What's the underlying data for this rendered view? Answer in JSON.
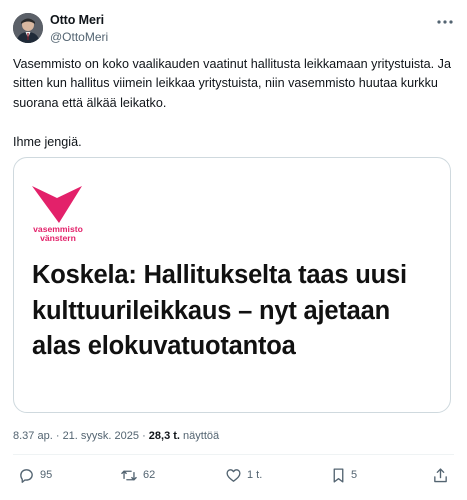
{
  "author": {
    "name": "Otto Meri",
    "handle": "@OttoMeri"
  },
  "post": {
    "paragraphs": [
      "Vasemmisto on koko vaalikauden vaatinut hallitusta leikkamaan yritystuista. Ja sitten kun hallitus viimein leikkaa yritystuista, niin vasemmisto huutaa kurkku suorana että älkää leikatko.",
      "Ihme jengiä."
    ]
  },
  "card": {
    "brand_line1": "vasemmisto",
    "brand_line2": "vänstern",
    "headline": "Koskela: Hallitukselta taas uusi kulttuurileikkaus – nyt ajetaan alas elokuvatuotantoa"
  },
  "meta": {
    "time": "8.37 ap.",
    "separator": "·",
    "date": "21. syysk. 2025",
    "views_count": "28,3 t.",
    "views_label": "näyttöä"
  },
  "actions": {
    "replies": "95",
    "reposts": "62",
    "likes": "1 t.",
    "bookmarks": "5"
  },
  "icons": {
    "more": "more-icon",
    "reply": "reply-icon",
    "repost": "repost-icon",
    "like": "heart-icon",
    "bookmark": "bookmark-icon",
    "share": "share-icon"
  },
  "colors": {
    "brand_pink": "#e3216a",
    "text_primary": "#0f1419",
    "text_secondary": "#536471",
    "border": "#cfd9de"
  }
}
